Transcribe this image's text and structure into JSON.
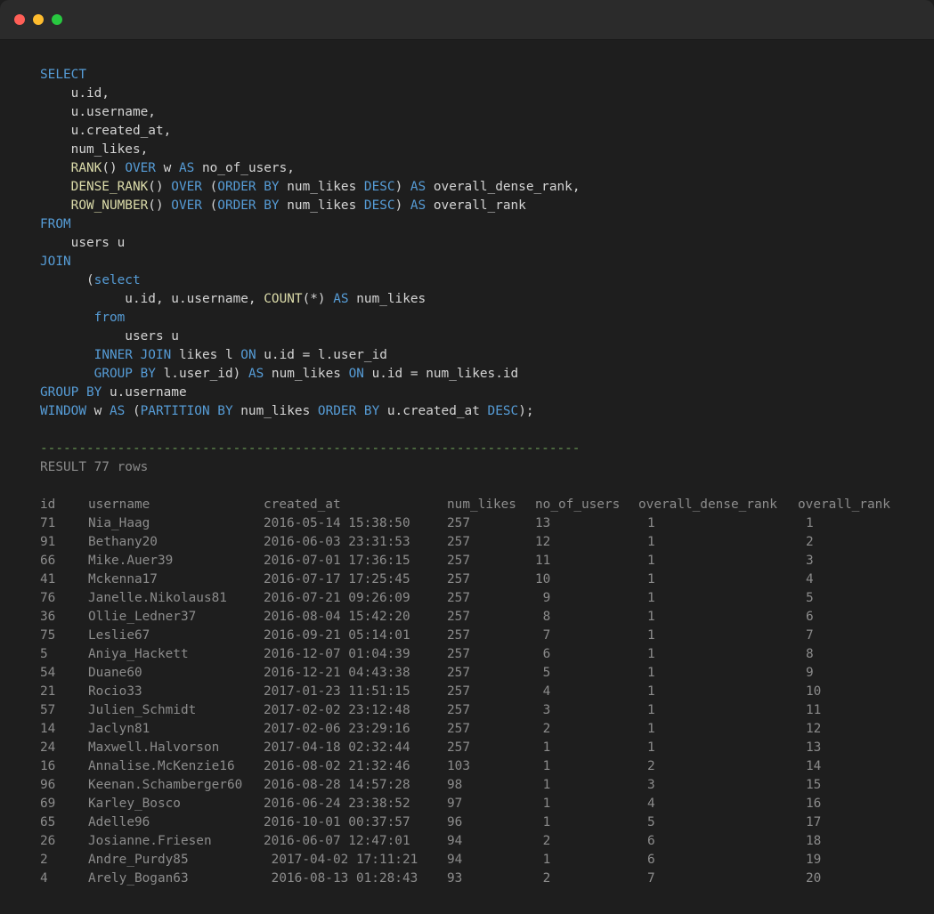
{
  "query": {
    "lines": [
      [
        {
          "t": "SELECT",
          "c": "kw"
        }
      ],
      [
        {
          "t": "    u.id,"
        }
      ],
      [
        {
          "t": "    u.username,"
        }
      ],
      [
        {
          "t": "    u.created_at,"
        }
      ],
      [
        {
          "t": "    num_likes,"
        }
      ],
      [
        {
          "t": "    "
        },
        {
          "t": "RANK",
          "c": "fn"
        },
        {
          "t": "() "
        },
        {
          "t": "OVER",
          "c": "kw"
        },
        {
          "t": " w "
        },
        {
          "t": "AS",
          "c": "kw"
        },
        {
          "t": " no_of_users,"
        }
      ],
      [
        {
          "t": "    "
        },
        {
          "t": "DENSE_RANK",
          "c": "fn"
        },
        {
          "t": "() "
        },
        {
          "t": "OVER",
          "c": "kw"
        },
        {
          "t": " ("
        },
        {
          "t": "ORDER BY",
          "c": "kw"
        },
        {
          "t": " num_likes "
        },
        {
          "t": "DESC",
          "c": "kw"
        },
        {
          "t": ") "
        },
        {
          "t": "AS",
          "c": "kw"
        },
        {
          "t": " overall_dense_rank,"
        }
      ],
      [
        {
          "t": "    "
        },
        {
          "t": "ROW_NUMBER",
          "c": "fn"
        },
        {
          "t": "() "
        },
        {
          "t": "OVER",
          "c": "kw"
        },
        {
          "t": " ("
        },
        {
          "t": "ORDER BY",
          "c": "kw"
        },
        {
          "t": " num_likes "
        },
        {
          "t": "DESC",
          "c": "kw"
        },
        {
          "t": ") "
        },
        {
          "t": "AS",
          "c": "kw"
        },
        {
          "t": " overall_rank"
        }
      ],
      [
        {
          "t": "FROM",
          "c": "kw"
        }
      ],
      [
        {
          "t": "    users u"
        }
      ],
      [
        {
          "t": "JOIN",
          "c": "kw"
        }
      ],
      [
        {
          "t": "      ("
        },
        {
          "t": "select",
          "c": "kw"
        }
      ],
      [
        {
          "t": "           u.id, u.username, "
        },
        {
          "t": "COUNT",
          "c": "fn"
        },
        {
          "t": "(*) "
        },
        {
          "t": "AS",
          "c": "kw"
        },
        {
          "t": " num_likes"
        }
      ],
      [
        {
          "t": "       "
        },
        {
          "t": "from",
          "c": "kw"
        }
      ],
      [
        {
          "t": "           users u"
        }
      ],
      [
        {
          "t": "       "
        },
        {
          "t": "INNER JOIN",
          "c": "kw"
        },
        {
          "t": " likes l "
        },
        {
          "t": "ON",
          "c": "kw"
        },
        {
          "t": " u.id = l.user_id"
        }
      ],
      [
        {
          "t": "       "
        },
        {
          "t": "GROUP BY",
          "c": "kw"
        },
        {
          "t": " l.user_id) "
        },
        {
          "t": "AS",
          "c": "kw"
        },
        {
          "t": " num_likes "
        },
        {
          "t": "ON",
          "c": "kw"
        },
        {
          "t": " u.id = num_likes.id"
        }
      ],
      [
        {
          "t": "GROUP BY",
          "c": "kw"
        },
        {
          "t": " u.username"
        }
      ],
      [
        {
          "t": "WINDOW",
          "c": "kw"
        },
        {
          "t": " w "
        },
        {
          "t": "AS",
          "c": "kw"
        },
        {
          "t": " ("
        },
        {
          "t": "PARTITION BY",
          "c": "kw"
        },
        {
          "t": " num_likes "
        },
        {
          "t": "ORDER BY",
          "c": "kw"
        },
        {
          "t": " u.created_at "
        },
        {
          "t": "DESC",
          "c": "kw"
        },
        {
          "t": ");"
        }
      ]
    ]
  },
  "separator": "----------------------------------------------------------------------",
  "result_label": "RESULT 77 rows",
  "table": {
    "columns": [
      "id",
      "username",
      "created_at",
      "num_likes",
      "no_of_users",
      "overall_dense_rank",
      "overall_rank"
    ],
    "rows": [
      [
        "71",
        "Nia_Haag",
        "2016-05-14 15:38:50",
        "257",
        "13",
        "1",
        "1"
      ],
      [
        "91",
        "Bethany20",
        "2016-06-03 23:31:53",
        "257",
        "12",
        "1",
        "2"
      ],
      [
        "66",
        "Mike.Auer39",
        "2016-07-01 17:36:15",
        "257",
        "11",
        "1",
        "3"
      ],
      [
        "41",
        "Mckenna17",
        "2016-07-17 17:25:45",
        "257",
        "10",
        "1",
        "4"
      ],
      [
        "76",
        "Janelle.Nikolaus81",
        "2016-07-21 09:26:09",
        "257",
        " 9",
        "1",
        "5"
      ],
      [
        "36",
        "Ollie_Ledner37",
        "2016-08-04 15:42:20",
        "257",
        " 8",
        "1",
        "6"
      ],
      [
        "75",
        "Leslie67",
        "2016-09-21 05:14:01",
        "257",
        " 7",
        "1",
        "7"
      ],
      [
        "5",
        "Aniya_Hackett",
        "2016-12-07 01:04:39",
        "257",
        " 6",
        "1",
        "8"
      ],
      [
        "54",
        "Duane60",
        "2016-12-21 04:43:38",
        "257",
        " 5",
        "1",
        "9"
      ],
      [
        "21",
        "Rocio33",
        "2017-01-23 11:51:15",
        "257",
        " 4",
        "1",
        "10"
      ],
      [
        "57",
        "Julien_Schmidt",
        "2017-02-02 23:12:48",
        "257",
        " 3",
        "1",
        "11"
      ],
      [
        "14",
        "Jaclyn81",
        "2017-02-06 23:29:16",
        "257",
        " 2",
        "1",
        "12"
      ],
      [
        "24",
        "Maxwell.Halvorson",
        "2017-04-18 02:32:44",
        "257",
        " 1",
        "1",
        "13"
      ],
      [
        "16",
        "Annalise.McKenzie16",
        "2016-08-02 21:32:46",
        "103",
        " 1",
        "2",
        "14"
      ],
      [
        "96",
        "Keenan.Schamberger60",
        "2016-08-28 14:57:28",
        "98",
        " 1",
        "3",
        "15"
      ],
      [
        "69",
        "Karley_Bosco",
        "2016-06-24 23:38:52",
        "97",
        " 1",
        "4",
        "16"
      ],
      [
        "65",
        "Adelle96",
        "2016-10-01 00:37:57",
        "96",
        " 1",
        "5",
        "17"
      ],
      [
        "26",
        "Josianne.Friesen",
        "2016-06-07 12:47:01",
        "94",
        " 2",
        "6",
        "18"
      ],
      [
        "2",
        "Andre_Purdy85",
        " 2017-04-02 17:11:21",
        "94",
        " 1",
        "6",
        "19"
      ],
      [
        "4",
        "Arely_Bogan63",
        " 2016-08-13 01:28:43",
        "93",
        " 2",
        "7",
        "20"
      ]
    ]
  },
  "colors": {
    "keyword": "#569cd6",
    "function": "#dcdcaa",
    "separator": "#6a9955",
    "text": "#d4d4d4",
    "muted": "#8c8c8c"
  }
}
